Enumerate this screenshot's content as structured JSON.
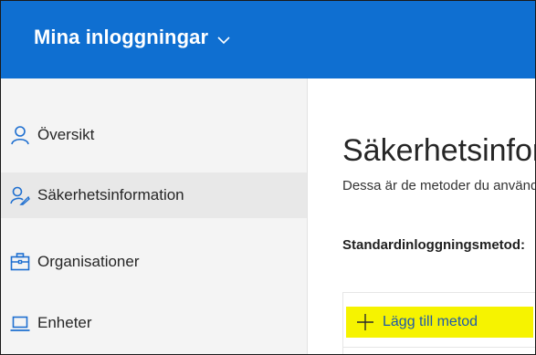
{
  "header": {
    "app_title": "Mina inloggningar",
    "chevron_icon": "chevron-down-icon",
    "background_color": "#0f6fd1"
  },
  "sidebar": {
    "items": [
      {
        "label": "Översikt",
        "icon": "person-icon",
        "active": false
      },
      {
        "label": "Säkerhetsinformation",
        "icon": "security-info-icon",
        "active": true
      },
      {
        "label": "Organisationer",
        "icon": "briefcase-icon",
        "active": false
      },
      {
        "label": "Enheter",
        "icon": "laptop-icon",
        "active": false
      }
    ]
  },
  "main": {
    "title": "Säkerhetsinformation",
    "description": "Dessa är de metoder du använder för att logga in på ditt konto eller återställa ditt lösenord.",
    "default_method_label": "Standardinloggningsmetod:",
    "add_method_label": "Lägg till metod",
    "highlight_color": "#f6f300",
    "accent_color": "#1e5aa8"
  }
}
